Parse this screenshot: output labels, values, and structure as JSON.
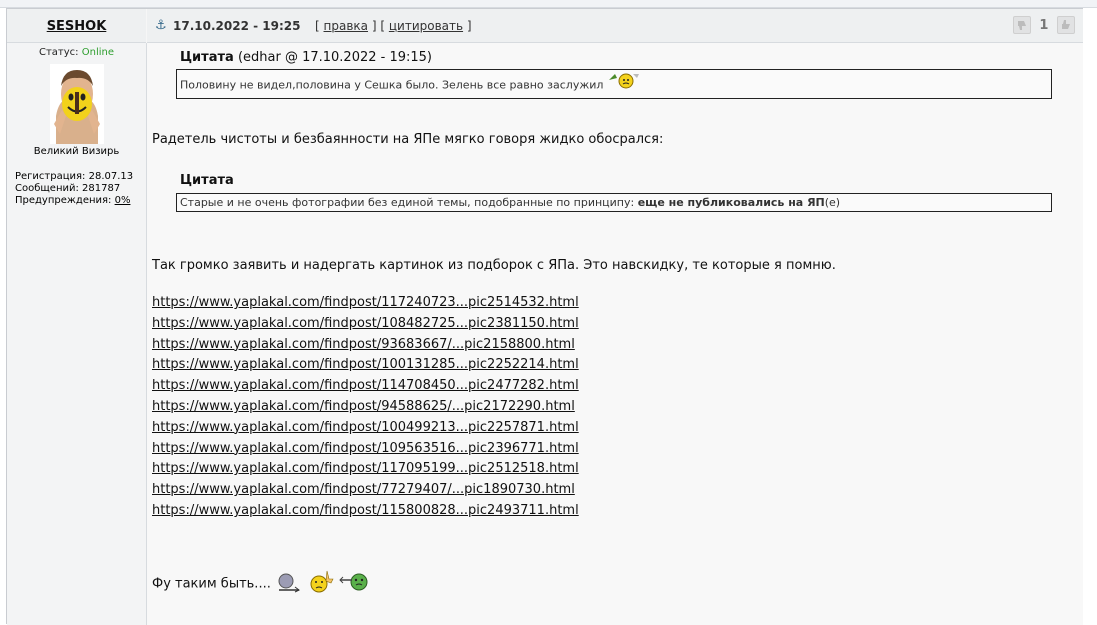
{
  "user": {
    "name": "SESHOK",
    "status_label": "Статус:",
    "status_value": "Online",
    "rank": "Великий Визирь",
    "registration": "Регистрация: 28.07.13",
    "messages": "Сообщений: 281787",
    "warnings_label": "Предупреждения:",
    "warnings_value": "0%"
  },
  "post": {
    "date": "17.10.2022 - 19:25",
    "open_bracket": "[",
    "edit_label": "правка",
    "mid_bracket": "] [",
    "quote_label": "цитировать",
    "close_bracket": "]",
    "rating_value": "1"
  },
  "quote1": {
    "title": "Цитата",
    "author": "(edhar @ 17.10.2022 - 19:15)",
    "text": "Половину не видел,половина у Сешка было. Зелень все равно заслужил"
  },
  "para1": "Радетель чистоты и безбаянности на ЯПе мягко говоря жидко обосрался:",
  "quote2": {
    "title": "Цитата",
    "text_start": "Старые и не очень фотографии без единой темы, подобранные по принципу: ",
    "text_bold": "еще не публиковались на ЯП",
    "text_end": "(е)"
  },
  "para2": "Так громко заявить и надергать картинок из подборок с ЯПа. Это навскидку, те которые я помню.",
  "links": [
    "https://www.yaplakal.com/findpost/117240723...pic2514532.html",
    "https://www.yaplakal.com/findpost/108482725...pic2381150.html",
    "https://www.yaplakal.com/findpost/93683667/...pic2158800.html",
    "https://www.yaplakal.com/findpost/100131285...pic2252214.html",
    "https://www.yaplakal.com/findpost/114708450...pic2477282.html",
    "https://www.yaplakal.com/findpost/94588625/...pic2172290.html",
    "https://www.yaplakal.com/findpost/100499213...pic2257871.html",
    "https://www.yaplakal.com/findpost/109563516...pic2396771.html",
    "https://www.yaplakal.com/findpost/117095199...pic2512518.html",
    "https://www.yaplakal.com/findpost/77279407/...pic1890730.html",
    "https://www.yaplakal.com/findpost/115800828...pic2493711.html"
  ],
  "para3": "Фу таким быть....",
  "signature_divider": "--------------------",
  "colors": {
    "online": "#2e9e2e",
    "anchor": "#3a6c8d"
  },
  "icons": {
    "anchor": "anchor-icon",
    "rate_down": "thumb-down-icon",
    "rate_up": "thumb-up-icon"
  }
}
